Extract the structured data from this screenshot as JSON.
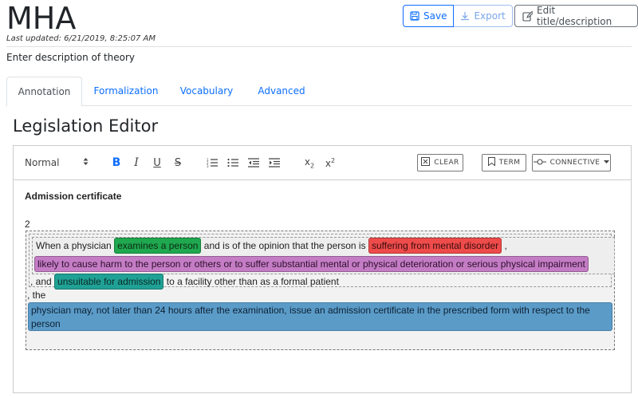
{
  "header": {
    "title": "MHA",
    "last_updated": "Last updated: 6/21/2019, 8:25:07 AM",
    "description": "Enter description of theory",
    "save_label": "Save",
    "export_label": "Export",
    "edit_label": "Edit title/description"
  },
  "tabs": [
    {
      "label": "Annotation",
      "active": true
    },
    {
      "label": "Formalization",
      "active": false
    },
    {
      "label": "Vocabulary",
      "active": false
    },
    {
      "label": "Advanced",
      "active": false
    }
  ],
  "editor": {
    "heading": "Legislation Editor",
    "toolbar": {
      "paragraph_style": "Normal",
      "clear_label": "Clear",
      "term_label": "Term",
      "connective_label": "Connective"
    },
    "content": {
      "heading": "Admission certificate",
      "section_number": "2",
      "line1_pre": "When a physician",
      "line1_chip1": "examines a person",
      "line1_mid": "and is of the opinion that the person is",
      "line1_chip2": "suffering from mental disorder",
      "line1_post": ",",
      "line2_chip": "likely to cause harm to the person or others or to suffer substantial mental or physical deterioration or serious physical impairment",
      "line3_pre": ", and",
      "line3_chip": "unsuitable for admission",
      "line3_post": "to a facility other than as a formal patient",
      "line4": ", the",
      "line5": "physician may, not later than 24 hours after the examination, issue an admission certificate in the prescribed form with respect to the person"
    }
  },
  "colors": {
    "primary": "#0d6efd",
    "chip_green": "#1fa84f",
    "chip_red": "#ee4b4b",
    "chip_purple": "#c47dc4",
    "chip_teal": "#20a195",
    "chip_blue": "#5b9bc8"
  },
  "icons": [
    "save-icon",
    "download-icon",
    "edit-icon",
    "bold-icon",
    "italic-icon",
    "underline-icon",
    "strikethrough-icon",
    "ordered-list-icon",
    "bullet-list-icon",
    "outdent-icon",
    "indent-icon",
    "subscript-icon",
    "superscript-icon",
    "clear-icon",
    "bookmark-icon",
    "connective-icon"
  ]
}
